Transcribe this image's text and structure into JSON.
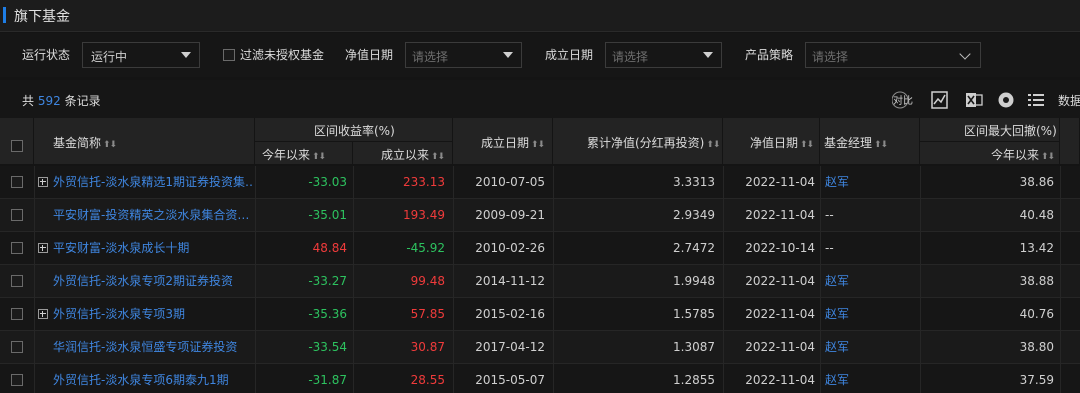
{
  "section": {
    "title": "旗下基金"
  },
  "filters": {
    "status_label": "运行状态",
    "status_value": "运行中",
    "unauth_label": "过滤未授权基金",
    "nav_date_label": "净值日期",
    "nav_date_placeholder": "请选择",
    "inception_label": "成立日期",
    "inception_placeholder": "请选择",
    "strategy_label": "产品策略",
    "strategy_placeholder": "请选择"
  },
  "summary": {
    "prefix": "共",
    "count": "592",
    "suffix": "条记录",
    "toolbar_text": "数据"
  },
  "toolbar": {
    "compare_icon_text": "对比"
  },
  "table": {
    "headers": {
      "name": "基金简称",
      "interval_return_group": "区间收益率(%)",
      "ytd": "今年以来",
      "since_inception": "成立以来",
      "inception_date": "成立日期",
      "cum_nav": "累计净值(分红再投资)",
      "nav_date": "净值日期",
      "manager": "基金经理",
      "drawdown_group": "区间最大回撤(%)",
      "drawdown_ytd": "今年以来",
      "sort_glyph": "⬆⬇"
    },
    "rows": [
      {
        "expand": true,
        "name": "外贸信托-淡水泉精选1期证券投资集…",
        "ytd": "-33.03",
        "ytd_sign": "neg",
        "since": "233.13",
        "since_sign": "pos",
        "inception": "2010-07-05",
        "nav": "3.3313",
        "nav_date": "2022-11-04",
        "manager": "赵军",
        "manager_link": true,
        "drawdown": "38.86"
      },
      {
        "expand": false,
        "name": "平安财富-投资精英之淡水泉集合资…",
        "ytd": "-35.01",
        "ytd_sign": "neg",
        "since": "193.49",
        "since_sign": "pos",
        "inception": "2009-09-21",
        "nav": "2.9349",
        "nav_date": "2022-11-04",
        "manager": "--",
        "manager_link": false,
        "drawdown": "40.48"
      },
      {
        "expand": true,
        "name": "平安财富-淡水泉成长十期",
        "ytd": "48.84",
        "ytd_sign": "pos",
        "since": "-45.92",
        "since_sign": "neg",
        "inception": "2010-02-26",
        "nav": "2.7472",
        "nav_date": "2022-10-14",
        "manager": "--",
        "manager_link": false,
        "drawdown": "13.42"
      },
      {
        "expand": false,
        "name": "外贸信托-淡水泉专项2期证券投资",
        "ytd": "-33.27",
        "ytd_sign": "neg",
        "since": "99.48",
        "since_sign": "pos",
        "inception": "2014-11-12",
        "nav": "1.9948",
        "nav_date": "2022-11-04",
        "manager": "赵军",
        "manager_link": true,
        "drawdown": "38.88"
      },
      {
        "expand": true,
        "name": "外贸信托-淡水泉专项3期",
        "ytd": "-35.36",
        "ytd_sign": "neg",
        "since": "57.85",
        "since_sign": "pos",
        "inception": "2015-02-16",
        "nav": "1.5785",
        "nav_date": "2022-11-04",
        "manager": "赵军",
        "manager_link": true,
        "drawdown": "40.76"
      },
      {
        "expand": false,
        "name": "华润信托-淡水泉恒盛专项证券投资",
        "ytd": "-33.54",
        "ytd_sign": "neg",
        "since": "30.87",
        "since_sign": "pos",
        "inception": "2017-04-12",
        "nav": "1.3087",
        "nav_date": "2022-11-04",
        "manager": "赵军",
        "manager_link": true,
        "drawdown": "38.80"
      },
      {
        "expand": false,
        "name": "外贸信托-淡水泉专项6期泰九1期",
        "ytd": "-31.87",
        "ytd_sign": "neg",
        "since": "28.55",
        "since_sign": "pos",
        "inception": "2015-05-07",
        "nav": "1.2855",
        "nav_date": "2022-11-04",
        "manager": "赵军",
        "manager_link": true,
        "drawdown": "37.59"
      }
    ]
  },
  "colors": {
    "accent": "#1e7ee6",
    "link": "#3f86e0",
    "negative": "#2dc25f",
    "positive": "#f03b3b"
  }
}
